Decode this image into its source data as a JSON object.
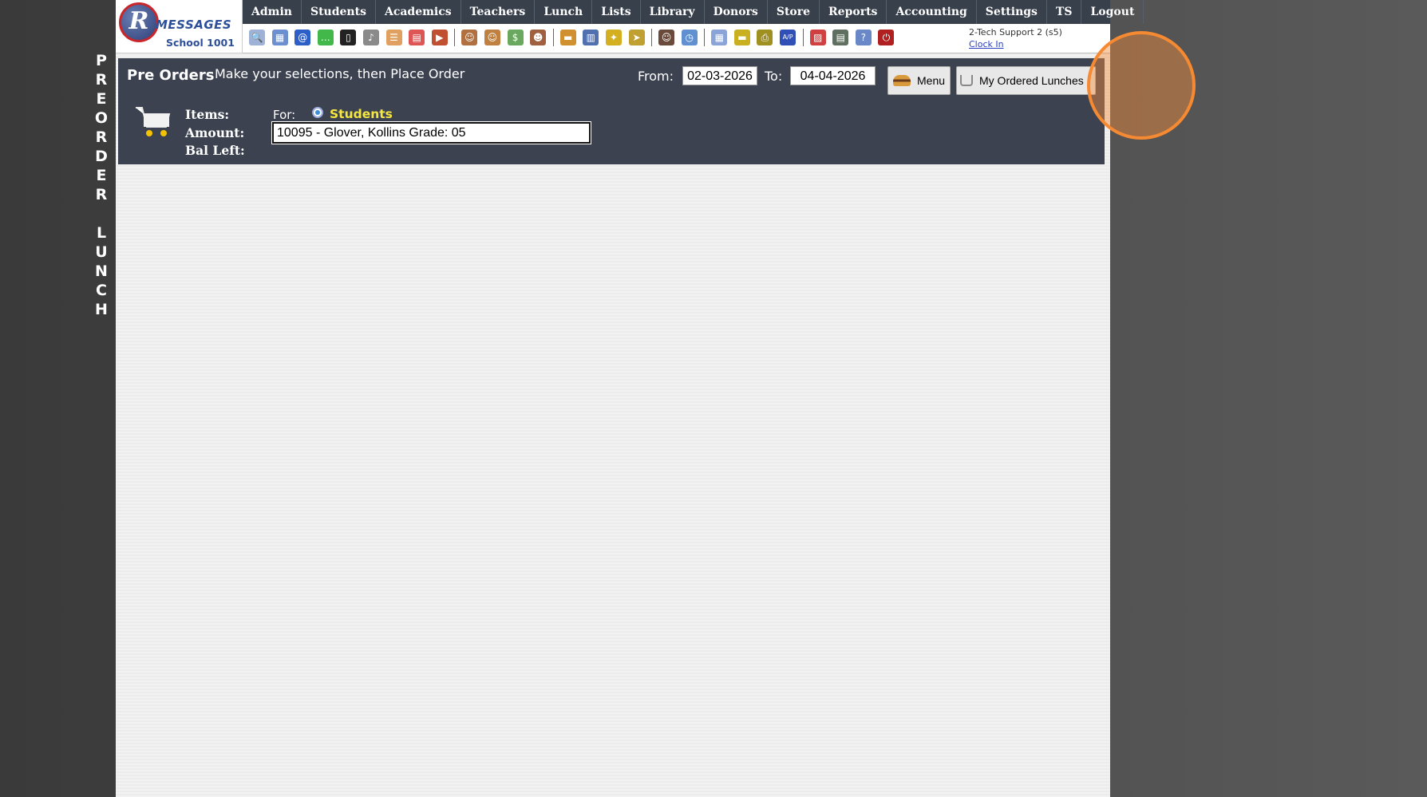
{
  "side_label": [
    "P",
    "R",
    "E",
    "O",
    "R",
    "D",
    "E",
    "R",
    "",
    "L",
    "U",
    "N",
    "C",
    "H"
  ],
  "logo": {
    "letter": "R",
    "brand": "MESSAGES",
    "school": "School 1001"
  },
  "nav": [
    "Admin",
    "Students",
    "Academics",
    "Teachers",
    "Lunch",
    "Lists",
    "Library",
    "Donors",
    "Store",
    "Reports",
    "Accounting",
    "Settings",
    "TS",
    "Logout"
  ],
  "toolbar_icons": [
    {
      "name": "search-icon",
      "glyph": "🔍",
      "color": "#9db2d6"
    },
    {
      "name": "calendar-grid-icon",
      "glyph": "▦",
      "color": "#6c8fd0"
    },
    {
      "name": "email-icon",
      "glyph": "@",
      "color": "#2c5fc8"
    },
    {
      "name": "chat-icon",
      "glyph": "…",
      "color": "#42b84a"
    },
    {
      "name": "mobile-icon",
      "glyph": "▯",
      "color": "#222"
    },
    {
      "name": "speaker-icon",
      "glyph": "♪",
      "color": "#8a8a8a"
    },
    {
      "name": "form-icon",
      "glyph": "☰",
      "color": "#e0a060"
    },
    {
      "name": "calendar-icon",
      "glyph": "▤",
      "color": "#d55"
    },
    {
      "name": "megaphone-icon",
      "glyph": "▶",
      "color": "#c05030"
    },
    {
      "name": "sep",
      "glyph": "",
      "color": ""
    },
    {
      "name": "add-student-icon",
      "glyph": "☺",
      "color": "#b07040"
    },
    {
      "name": "student-icon",
      "glyph": "☺",
      "color": "#c08040"
    },
    {
      "name": "money-icon",
      "glyph": "$",
      "color": "#6aa860"
    },
    {
      "name": "family-icon",
      "glyph": "☻",
      "color": "#a06040"
    },
    {
      "name": "sep",
      "glyph": "",
      "color": ""
    },
    {
      "name": "lunch-icon",
      "glyph": "▬",
      "color": "#d09030"
    },
    {
      "name": "book-icon",
      "glyph": "▥",
      "color": "#5070b0"
    },
    {
      "name": "broom-icon",
      "glyph": "✦",
      "color": "#d4b020"
    },
    {
      "name": "export-icon",
      "glyph": "➤",
      "color": "#c0a030"
    },
    {
      "name": "sep",
      "glyph": "",
      "color": ""
    },
    {
      "name": "teacher-icon",
      "glyph": "☺",
      "color": "#6a4a3a"
    },
    {
      "name": "clock-icon",
      "glyph": "◷",
      "color": "#6090d0"
    },
    {
      "name": "sep",
      "glyph": "",
      "color": ""
    },
    {
      "name": "grid-icon",
      "glyph": "▦",
      "color": "#8aa4d8"
    },
    {
      "name": "card-icon",
      "glyph": "▬",
      "color": "#c8b020"
    },
    {
      "name": "printer-icon",
      "glyph": "⎙",
      "color": "#a09020"
    },
    {
      "name": "ap-icon",
      "glyph": "A/P",
      "color": "#3050b8"
    },
    {
      "name": "sep",
      "glyph": "",
      "color": ""
    },
    {
      "name": "pdf-icon",
      "glyph": "▨",
      "color": "#d04040"
    },
    {
      "name": "cash-icon",
      "glyph": "▤",
      "color": "#607060"
    },
    {
      "name": "help-icon",
      "glyph": "?",
      "color": "#6a88c8"
    },
    {
      "name": "power-icon",
      "glyph": "⏻",
      "color": "#b02020"
    }
  ],
  "user": {
    "name": "2-Tech Support 2 (s5)",
    "clock_link": "Clock In"
  },
  "panel": {
    "title": "Pre Orders",
    "subtitle": "Make your selections, then Place Order",
    "from_label": "From:",
    "from_value": "02-03-2026",
    "to_label": "To:",
    "to_value": "04-04-2026",
    "menu_button": "Menu",
    "my_lunches_button": "My Ordered Lunches",
    "items_label": "Items:",
    "amount_label": "Amount:",
    "bal_left_label": "Bal Left:",
    "for_label": "For:",
    "students_option": "Students",
    "student_value": "10095 - Glover, Kollins Grade: 05"
  },
  "colors": {
    "panel_bg": "#3c4250",
    "nav_bg": "#38404c",
    "highlight": "#f58a32",
    "students_label": "#f5e642"
  }
}
